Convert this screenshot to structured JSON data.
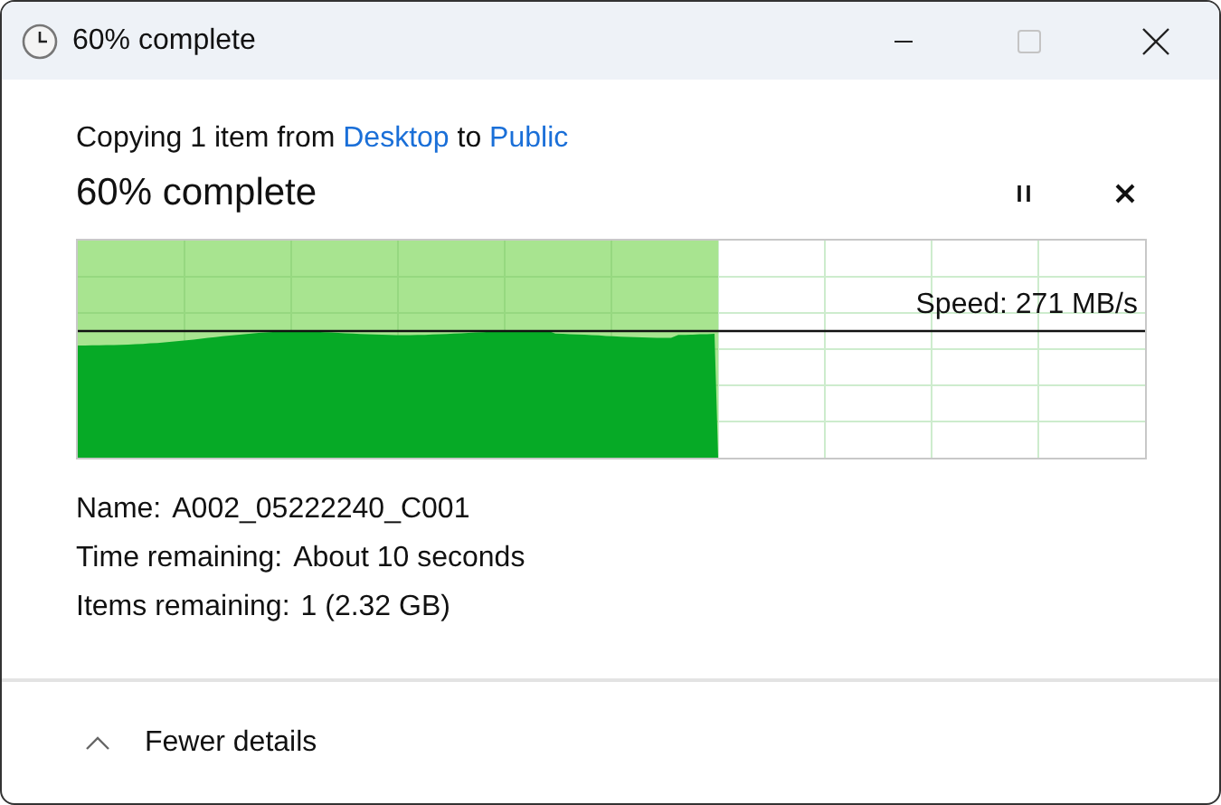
{
  "window": {
    "title": "60% complete",
    "maximize_disabled": true
  },
  "operation": {
    "prefix": "Copying 1 item from ",
    "source": "Desktop",
    "middle": " to ",
    "destination": "Public"
  },
  "progress": {
    "heading": "60% complete",
    "level": 0.6,
    "speed": "Speed: 271 MB/s"
  },
  "details": [
    {
      "label": "Name:",
      "value": "A002_05222240_C001"
    },
    {
      "label": "Time remaining:",
      "value": "About 10 seconds"
    },
    {
      "label": "Items remaining:",
      "value": "1 (2.32 GB)"
    }
  ],
  "footer": {
    "toggle": "Fewer details",
    "expanded": true
  }
}
